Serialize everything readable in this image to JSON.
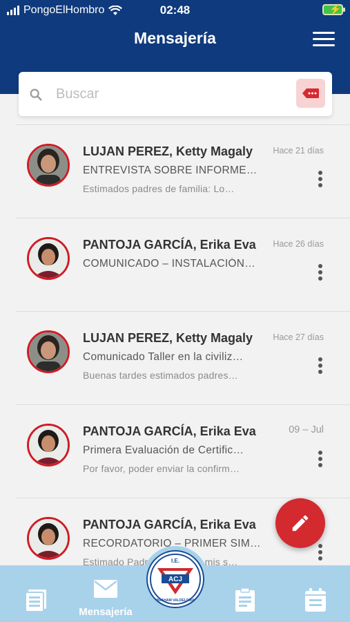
{
  "status_bar": {
    "carrier": "PongoElHombro",
    "time": "02:48"
  },
  "header": {
    "title": "Mensajería"
  },
  "search": {
    "placeholder": "Buscar"
  },
  "messages": [
    {
      "sender": "LUJAN PEREZ, Ketty Magaly",
      "subject": "ENTREVISTA SOBRE INFORME…",
      "preview": "Estimados padres de familia:   Lo…",
      "date": "Hace 21 días"
    },
    {
      "sender": "PANTOJA GARCÍA, Erika Eva",
      "subject": "COMUNICADO – INSTALACIÓN…",
      "preview": "",
      "date": "Hace 26 días"
    },
    {
      "sender": "LUJAN PEREZ, Ketty Magaly",
      "subject": "Comunicado Taller en la civiliz…",
      "preview": "Buenas tardes estimados padres…",
      "date": "Hace 27 días"
    },
    {
      "sender": "PANTOJA GARCÍA, Erika Eva",
      "subject": "Primera Evaluación de Certific…",
      "preview": "Por favor, poder enviar la confirm…",
      "date": "09 – Jul"
    },
    {
      "sender": "PANTOJA GARCÍA, Erika Eva",
      "subject": "RECORDATORIO – PRIMER SIM…",
      "preview": "Estimado Padre de familia, mis s…",
      "date": ""
    }
  ],
  "bottom_nav": {
    "messages_label": "Mensajería"
  },
  "logo": {
    "top_text": "I.E.",
    "center_text": "ACJ",
    "bottom_text": "ABRAHAM VALDELOMAR"
  },
  "colors": {
    "header": "#0f3a7d",
    "accent": "#d22a2f",
    "bottom_bar": "#a8d2ea"
  },
  "icons": [
    "search-icon",
    "tag-icon",
    "menu-icon",
    "more-vertical-icon",
    "pencil-icon",
    "news-icon",
    "mail-icon",
    "clipboard-icon",
    "calendar-icon"
  ]
}
